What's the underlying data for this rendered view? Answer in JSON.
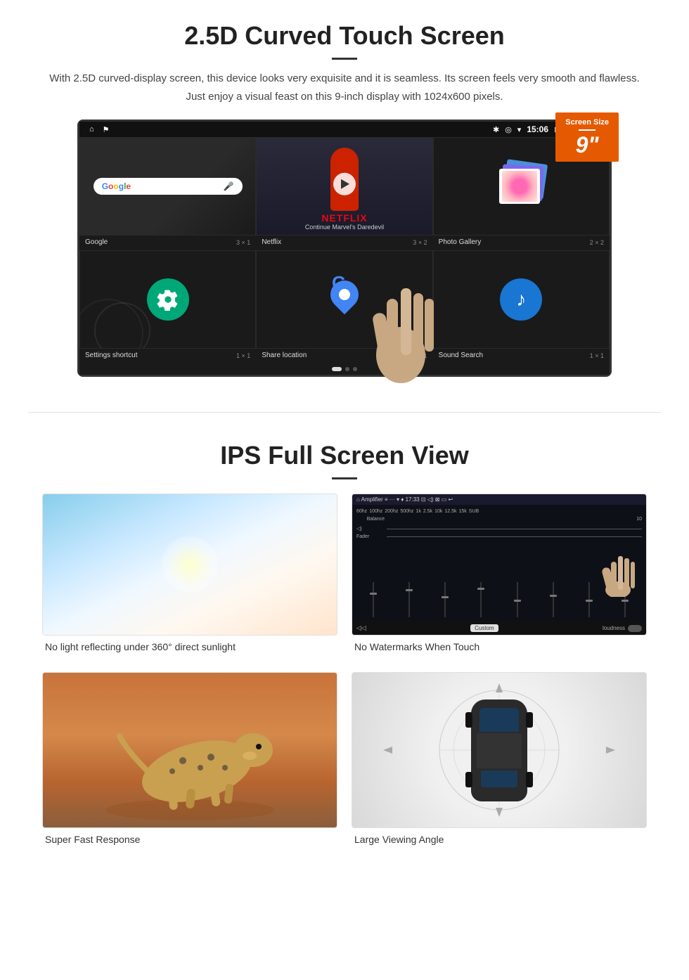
{
  "section1": {
    "title": "2.5D Curved Touch Screen",
    "description": "With 2.5D curved-display screen, this device looks very exquisite and it is seamless. Its screen feels very smooth and flawless. Just enjoy a visual feast on this 9-inch display with 1024x600 pixels.",
    "badge": {
      "label": "Screen Size",
      "size": "9\""
    },
    "statusbar": {
      "time": "15:06"
    },
    "apps": [
      {
        "name": "Google",
        "size": "3 × 1"
      },
      {
        "name": "Netflix",
        "size": "3 × 2"
      },
      {
        "name": "Photo Gallery",
        "size": "2 × 2"
      },
      {
        "name": "Settings shortcut",
        "size": "1 × 1"
      },
      {
        "name": "Share location",
        "size": "1 × 1"
      },
      {
        "name": "Sound Search",
        "size": "1 × 1"
      }
    ],
    "netflix": {
      "logo": "NETFLIX",
      "subtitle": "Continue Marvel's Daredevil"
    }
  },
  "section2": {
    "title": "IPS Full Screen View",
    "images": [
      {
        "caption": "No light reflecting under 360° direct sunlight"
      },
      {
        "caption": "No Watermarks When Touch"
      },
      {
        "caption": "Super Fast Response"
      },
      {
        "caption": "Large Viewing Angle"
      }
    ]
  }
}
